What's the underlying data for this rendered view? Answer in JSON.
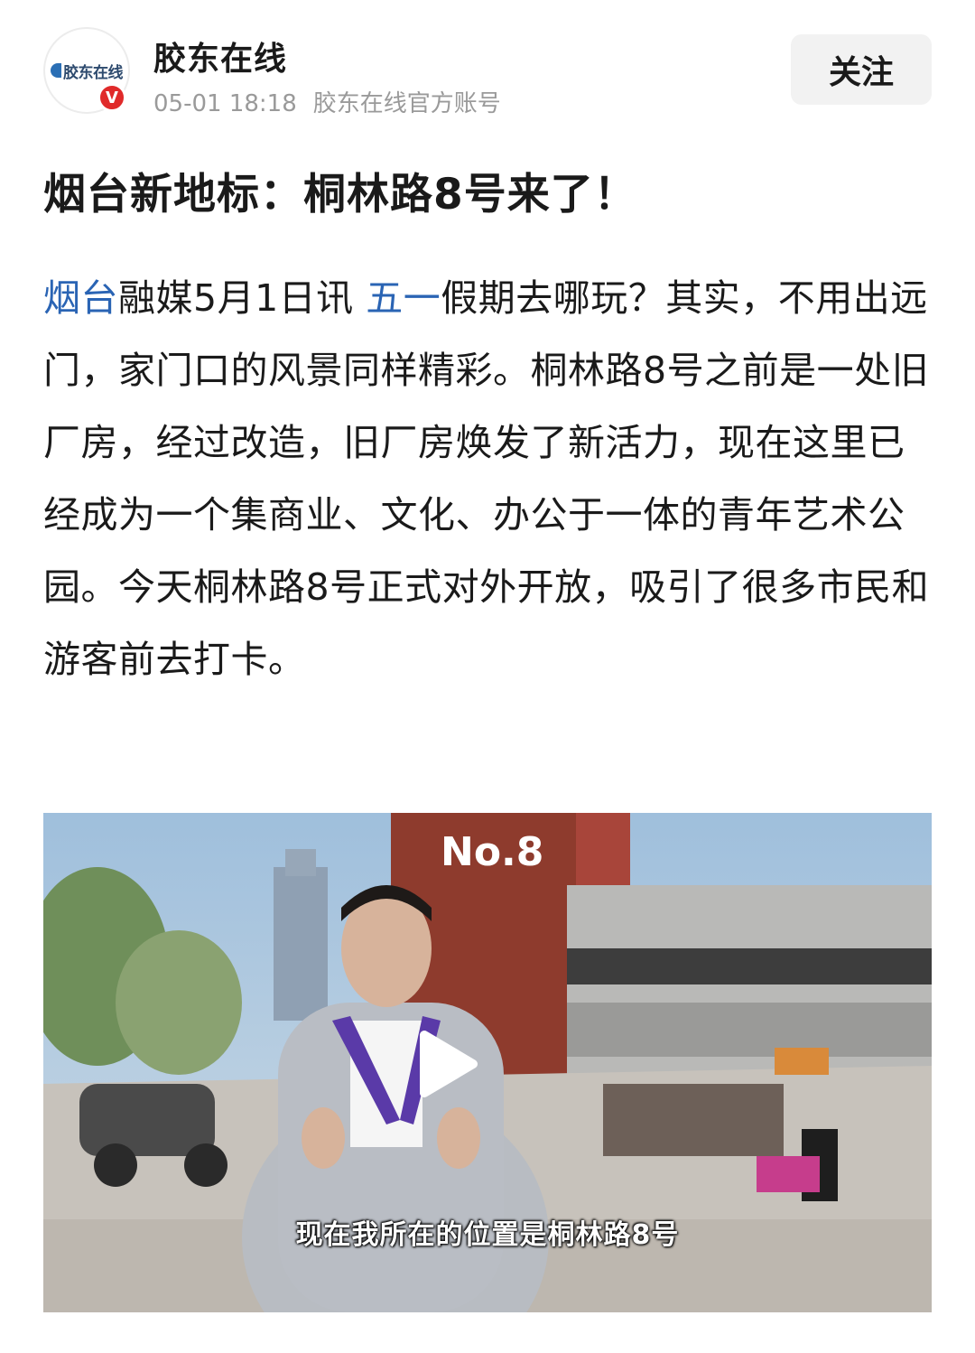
{
  "account": {
    "name": "胶东在线",
    "avatar_logo_text": "胶东在线",
    "verified_badge": "V",
    "date": "05-01 18:18",
    "description": "胶东在线官方账号"
  },
  "follow_button": {
    "label": "关注"
  },
  "article": {
    "title": "烟台新地标：桐林路8号来了！",
    "tag_1": "烟台",
    "text_1": "融媒5月1日讯 ",
    "tag_2": "五一",
    "text_2": "假期去哪玩？其实，不用出远门，家门口的风景同样精彩。桐林路8号之前是一处旧厂房，经过改造，旧厂房焕发了新活力，现在这里已经成为一个集商业、文化、办公于一体的青年艺术公园。今天桐林路8号正式对外开放，吸引了很多市民和游客前去打卡。"
  },
  "video": {
    "building_sign": "No.8",
    "subtitle": "现在我所在的位置是桐林路8号",
    "play_icon": "play-icon"
  },
  "colors": {
    "link": "#2a64b4",
    "verified": "#e02a2a",
    "follow_bg": "#f2f2f2",
    "meta_text": "#9a9a9a"
  }
}
